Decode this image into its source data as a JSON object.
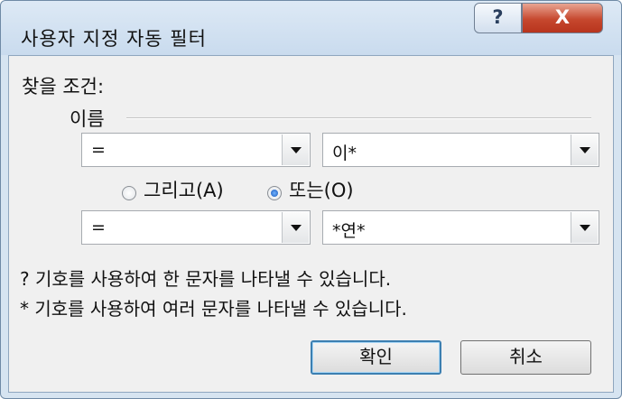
{
  "window": {
    "title": "사용자 지정 자동 필터",
    "help_label": "?",
    "close_label": "X"
  },
  "criteria": {
    "heading": "찾을 조건:",
    "field_name": "이름",
    "row1": {
      "operator": "=",
      "value": "이*"
    },
    "logic": {
      "and_label": "그리고(A)",
      "or_label": "또는(O)",
      "selected": "or"
    },
    "row2": {
      "operator": "=",
      "value": "*연*"
    }
  },
  "notes": {
    "line1": "? 기호를 사용하여 한 문자를 나타낼 수 있습니다.",
    "line2": "* 기호를 사용하여 여러 문자를 나타낼 수 있습니다."
  },
  "buttons": {
    "ok_label": "확인",
    "cancel_label": "취소"
  },
  "colors": {
    "title_bar": "#c9dbee",
    "close_button": "#c6482e",
    "dialog_body": "#f0f0f0",
    "radio_selected": "#1656b8"
  },
  "icons": {
    "help": "question-mark-icon",
    "close": "close-icon",
    "dropdown": "chevron-down-icon"
  }
}
